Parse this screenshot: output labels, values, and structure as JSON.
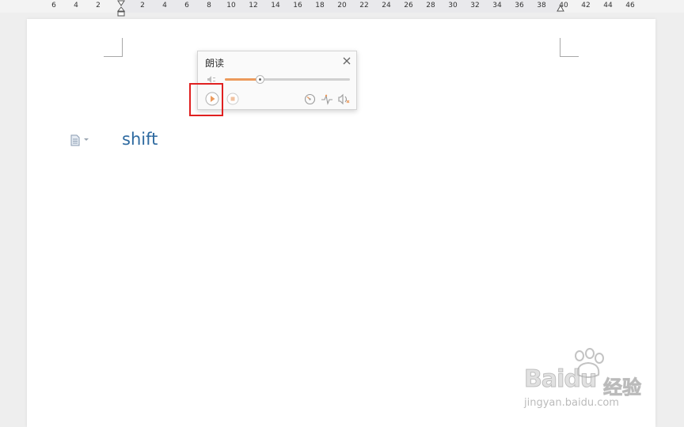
{
  "ruler": {
    "ticks": [
      "6",
      "4",
      "2",
      "2",
      "4",
      "6",
      "8",
      "10",
      "12",
      "14",
      "16",
      "18",
      "20",
      "22",
      "24",
      "26",
      "28",
      "30",
      "32",
      "34",
      "36",
      "38",
      "40",
      "42",
      "44",
      "46"
    ]
  },
  "document": {
    "body_text": "shift"
  },
  "read_aloud_panel": {
    "title": "朗读",
    "volume_percent": 28,
    "accent_color": "#ec9a5c"
  },
  "icons": {
    "close": "close-icon",
    "volume": "volume-icon",
    "play": "play-icon",
    "stop": "stop-icon",
    "speed": "speed-icon",
    "pitch": "pitch-icon",
    "voice": "voice-icon",
    "paragraph": "paragraph-marker-icon"
  },
  "highlight_color": "#e02020",
  "watermark": {
    "brand": "Baidu",
    "cn": "经验",
    "url": "jingyan.baidu.com"
  }
}
